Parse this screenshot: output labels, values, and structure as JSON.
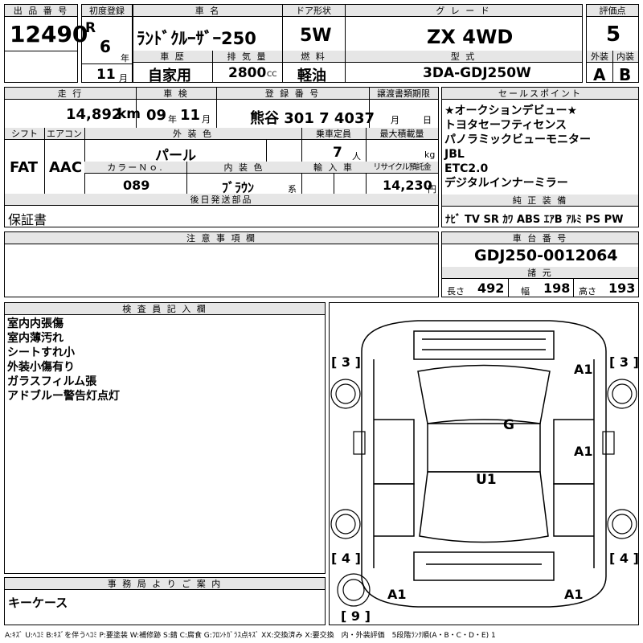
{
  "headers": {
    "lot_no": "出 品 番 号",
    "first_reg": "初度登録",
    "car_name": "車 名",
    "door": "ドア形状",
    "grade": "グ レ ー ド",
    "score": "評価点",
    "history": "車 歴",
    "displacement": "排 気 量",
    "fuel": "燃 料",
    "model_code": "型 式",
    "ext": "外装",
    "int": "内装",
    "mileage": "走 行",
    "inspection": "車 検",
    "reg_no": "登 録 番 号",
    "transfer_doc": "譲渡書類期限",
    "sales_points": "セールスポイント",
    "shift": "シフト",
    "aircon": "エアコン",
    "ext_color": "外 装 色",
    "capacity": "乗車定員",
    "max_load": "最大積載量",
    "color_no": "カラーＮｏ.",
    "int_color": "内 装 色",
    "import": "輸 入 車",
    "recycle": "リサイクル預託金",
    "later_parts": "後日発送部品",
    "genuine_eq": "純 正 装 備",
    "notes": "注 意 事 項 欄",
    "chassis_no": "車 台 番 号",
    "dimensions": "諸 元",
    "inspector": "検 査 員 記 入 欄",
    "office": "事 務 局 よ り ご 案 内"
  },
  "values": {
    "lot_no": "12490",
    "era": "R",
    "year": "6",
    "year_unit": "年",
    "month": "11",
    "month_unit": "月",
    "car_name": "ﾗﾝﾄﾞｸﾙｰｻﾞｰ250",
    "door": "5W",
    "grade": "ZX 4WD",
    "score": "5",
    "history": "自家用",
    "displacement": "2800",
    "cc": "CC",
    "fuel": "軽油",
    "model_code": "3DA-GDJ250W",
    "ext_score": "A",
    "int_score": "B",
    "mileage": "14,892",
    "km": "km",
    "insp_year": "09",
    "insp_year_unit": "年",
    "insp_month": "11",
    "insp_month_unit": "月",
    "reg_no": "熊谷 301 7 4037",
    "transfer_month": "月",
    "transfer_day": "日",
    "shift": "FAT",
    "aircon": "AAC",
    "ext_color": "パール",
    "capacity": "7",
    "capacity_unit": "人",
    "load_unit": "kg",
    "color_no": "089",
    "int_color": "ﾌﾞﾗｳﾝ",
    "int_color_unit": "系",
    "recycle": "14,230",
    "yen": "円",
    "later_parts": "保証書",
    "chassis_no": "GDJ250-0012064",
    "len_label": "長さ",
    "len": "492",
    "width_label": "幅",
    "width": "198",
    "height_label": "高さ",
    "height": "193",
    "office": "キーケース"
  },
  "sales_points": [
    "★オークションデビュー★",
    "トヨタセーフティセンス",
    "パノラミックビューモニター",
    "JBL",
    "ETC2.0",
    "デジタルインナーミラー"
  ],
  "genuine_eq": "ﾅﾋﾞ TV SR ｶﾜ ABS ｴｱB ｱﾙﾐ PS PW",
  "inspector_notes": [
    "室内内張傷",
    "室内薄汚れ",
    "シートすれ小",
    "外装小傷有り",
    "ガラスフィルム張",
    "アドブルー警告灯点灯"
  ],
  "diagram": {
    "tl": "[ 3 ]",
    "tr": "[ 3 ]",
    "bl": "[ 4 ]",
    "br": "[ 4 ]",
    "bottom": "[ 9 ]",
    "a1_fr": "A1",
    "g": "G",
    "a1_r": "A1",
    "u1": "U1",
    "a1_bl": "A1",
    "a1_br": "A1"
  },
  "legend": "A:ｷｽﾞ U:ﾍｺﾐ B:ｷｽﾞを伴うﾍｺﾐ P:要塗装 W:補修跡 S:錆 C:腐食 G:ﾌﾛﾝﾄｶﾞﾗｽ点ｷｽﾞ XX:交換済み X:要交換　内・外装評価　5段階ﾗﾝｸ順(A・B・C・D・E) 1"
}
